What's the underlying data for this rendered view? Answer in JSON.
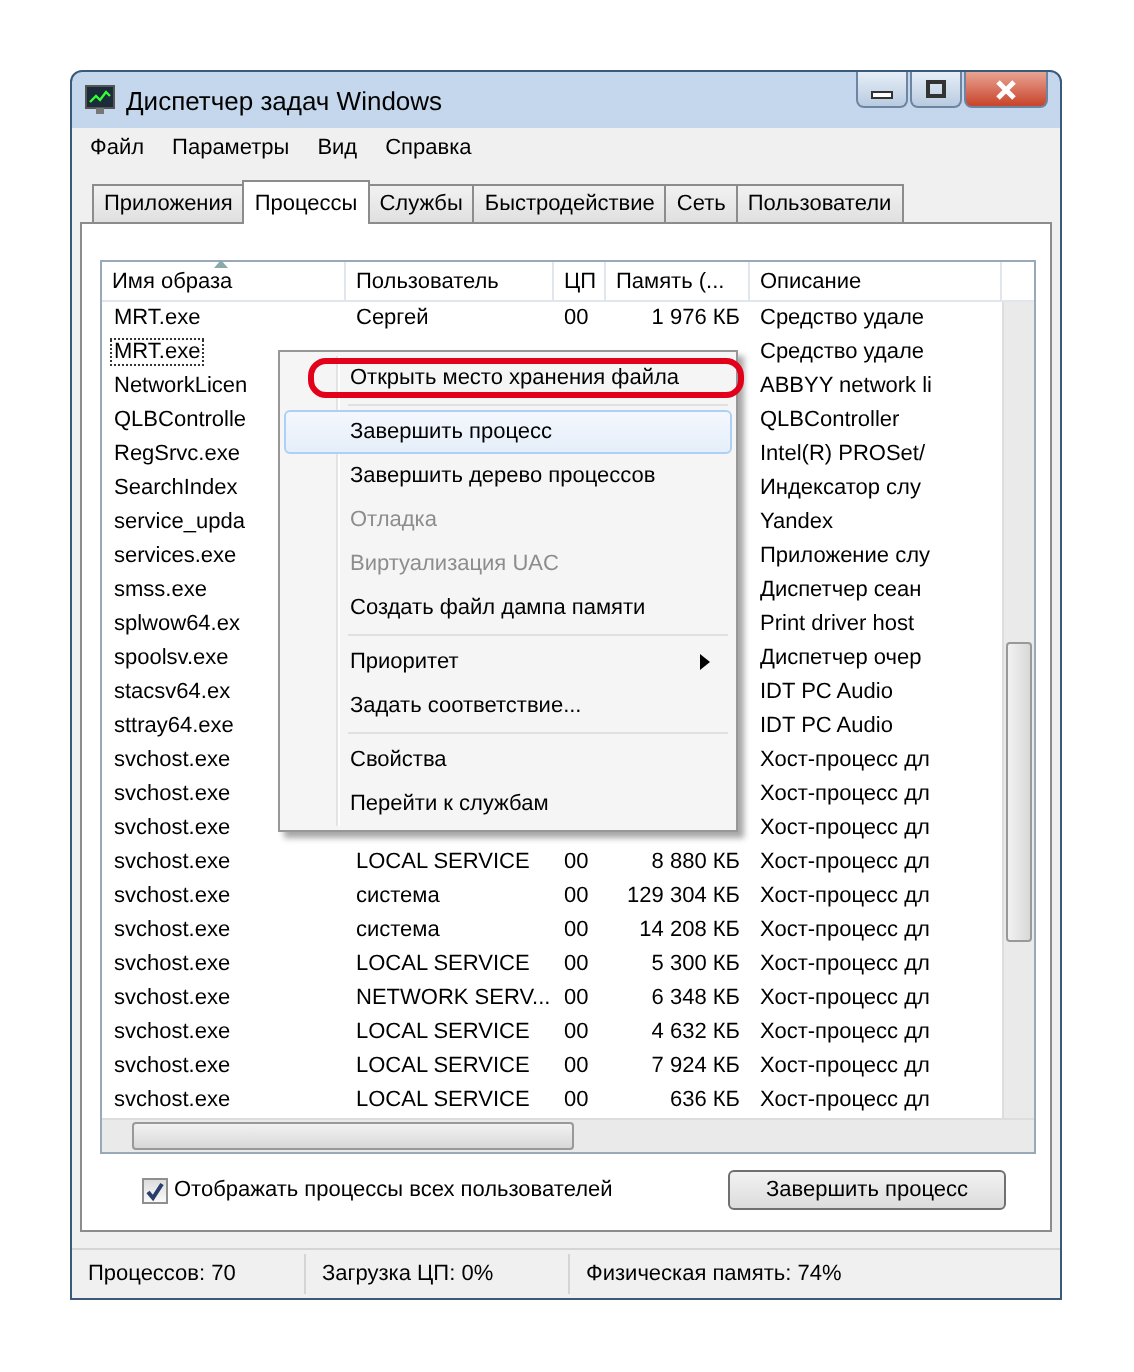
{
  "window": {
    "title": "Диспетчер задач Windows"
  },
  "menu": [
    "Файл",
    "Параметры",
    "Вид",
    "Справка"
  ],
  "tabs": [
    {
      "label": "Приложения",
      "selected": false
    },
    {
      "label": "Процессы",
      "selected": true
    },
    {
      "label": "Службы",
      "selected": false
    },
    {
      "label": "Быстродействие",
      "selected": false
    },
    {
      "label": "Сеть",
      "selected": false
    },
    {
      "label": "Пользователи",
      "selected": false
    }
  ],
  "table": {
    "columns": [
      "Имя образа",
      "Пользователь",
      "ЦП",
      "Память (...",
      "Описание"
    ],
    "rows": [
      {
        "name": "MRT.exe",
        "user": "Сергей",
        "cpu": "00",
        "memory": "1 976 КБ",
        "description": "Средство удале",
        "focused": false
      },
      {
        "name": "MRT.exe",
        "description": "Средство удале",
        "focused": true
      },
      {
        "name": "NetworkLicen",
        "description": "ABBYY network li",
        "focused": false
      },
      {
        "name": "QLBControlle",
        "description": "QLBController",
        "focused": false
      },
      {
        "name": "RegSrvc.exe",
        "description": "Intel(R) PROSet/",
        "focused": false
      },
      {
        "name": "SearchIndex",
        "description": "Индексатор слу",
        "focused": false
      },
      {
        "name": "service_upda",
        "description": "Yandex",
        "focused": false
      },
      {
        "name": "services.exe",
        "description": "Приложение слу",
        "focused": false
      },
      {
        "name": "smss.exe",
        "description": "Диспетчер сеан",
        "focused": false
      },
      {
        "name": "splwow64.ex",
        "description": "Print driver host",
        "focused": false
      },
      {
        "name": "spoolsv.exe",
        "description": "Диспетчер очер",
        "focused": false
      },
      {
        "name": "stacsv64.ex",
        "description": "IDT PC Audio",
        "focused": false
      },
      {
        "name": "sttray64.exe",
        "description": "IDT PC Audio",
        "focused": false
      },
      {
        "name": "svchost.exe",
        "description": "Хост-процесс дл",
        "focused": false
      },
      {
        "name": "svchost.exe",
        "description": "Хост-процесс дл",
        "focused": false
      },
      {
        "name": "svchost.exe",
        "description": "Хост-процесс дл",
        "focused": false
      },
      {
        "name": "svchost.exe",
        "user": "LOCAL SERVICE",
        "cpu": "00",
        "memory": "8 880 КБ",
        "description": "Хост-процесс дл",
        "focused": false
      },
      {
        "name": "svchost.exe",
        "user": "система",
        "cpu": "00",
        "memory": "129 304 КБ",
        "description": "Хост-процесс дл",
        "focused": false
      },
      {
        "name": "svchost.exe",
        "user": "система",
        "cpu": "00",
        "memory": "14 208 КБ",
        "description": "Хост-процесс дл",
        "focused": false
      },
      {
        "name": "svchost.exe",
        "user": "LOCAL SERVICE",
        "cpu": "00",
        "memory": "5 300 КБ",
        "description": "Хост-процесс дл",
        "focused": false
      },
      {
        "name": "svchost.exe",
        "user": "NETWORK SERV...",
        "cpu": "00",
        "memory": "6 348 КБ",
        "description": "Хост-процесс дл",
        "focused": false
      },
      {
        "name": "svchost.exe",
        "user": "LOCAL SERVICE",
        "cpu": "00",
        "memory": "4 632 КБ",
        "description": "Хост-процесс дл",
        "focused": false
      },
      {
        "name": "svchost.exe",
        "user": "LOCAL SERVICE",
        "cpu": "00",
        "memory": "7 924 КБ",
        "description": "Хост-процесс дл",
        "focused": false
      },
      {
        "name": "svchost.exe",
        "user": "LOCAL SERVICE",
        "cpu": "00",
        "memory": "636 КБ",
        "description": "Хост-процесс дл",
        "focused": false
      }
    ]
  },
  "context_menu": {
    "items": [
      {
        "kind": "item",
        "label": "Открыть место хранения файла",
        "selected": false,
        "disabled": false,
        "circled": true
      },
      {
        "kind": "separator"
      },
      {
        "kind": "item",
        "label": "Завершить процесс",
        "selected": true,
        "disabled": false,
        "circled": false
      },
      {
        "kind": "item",
        "label": "Завершить дерево процессов",
        "selected": false,
        "disabled": false,
        "circled": false
      },
      {
        "kind": "item",
        "label": "Отладка",
        "selected": false,
        "disabled": true,
        "circled": false
      },
      {
        "kind": "item",
        "label": "Виртуализация UAC",
        "selected": false,
        "disabled": true,
        "circled": false
      },
      {
        "kind": "item",
        "label": "Создать файл дампа памяти",
        "selected": false,
        "disabled": false,
        "circled": false
      },
      {
        "kind": "separator"
      },
      {
        "kind": "submenu",
        "label": "Приоритет",
        "selected": false,
        "disabled": false,
        "circled": false
      },
      {
        "kind": "item",
        "label": "Задать соответствие...",
        "selected": false,
        "disabled": false,
        "circled": false
      },
      {
        "kind": "separator"
      },
      {
        "kind": "item",
        "label": "Свойства",
        "selected": false,
        "disabled": false,
        "circled": false
      },
      {
        "kind": "item",
        "label": "Перейти к службам",
        "selected": false,
        "disabled": false,
        "circled": false
      }
    ]
  },
  "show_all_users": {
    "label": "Отображать процессы всех пользователей",
    "checked": true
  },
  "end_button": "Завершить процесс",
  "status_bar": [
    "Процессов: 70",
    "Загрузка ЦП: 0%",
    "Физическая память: 74%"
  ]
}
